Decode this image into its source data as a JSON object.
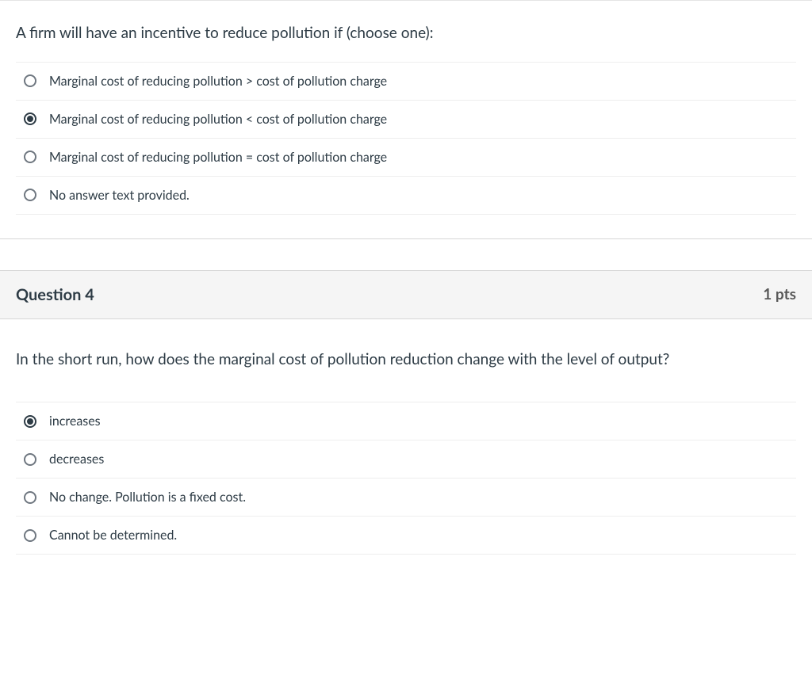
{
  "question1": {
    "prompt": "A firm will have an incentive to reduce pollution if (choose one):",
    "options": [
      {
        "label": "Marginal cost of reducing pollution > cost of pollution charge",
        "selected": false
      },
      {
        "label": "Marginal cost of reducing pollution < cost of pollution charge",
        "selected": true
      },
      {
        "label": "Marginal cost of reducing pollution = cost of pollution charge",
        "selected": false
      },
      {
        "label": "No answer text provided.",
        "selected": false
      }
    ]
  },
  "question2": {
    "header_title": "Question 4",
    "header_pts": "1 pts",
    "prompt": "In the short run, how does the marginal cost of pollution reduction change with the level of output?",
    "options": [
      {
        "label": "increases",
        "selected": true
      },
      {
        "label": "decreases",
        "selected": false
      },
      {
        "label": "No change. Pollution is a fixed cost.",
        "selected": false
      },
      {
        "label": "Cannot be determined.",
        "selected": false
      }
    ]
  }
}
